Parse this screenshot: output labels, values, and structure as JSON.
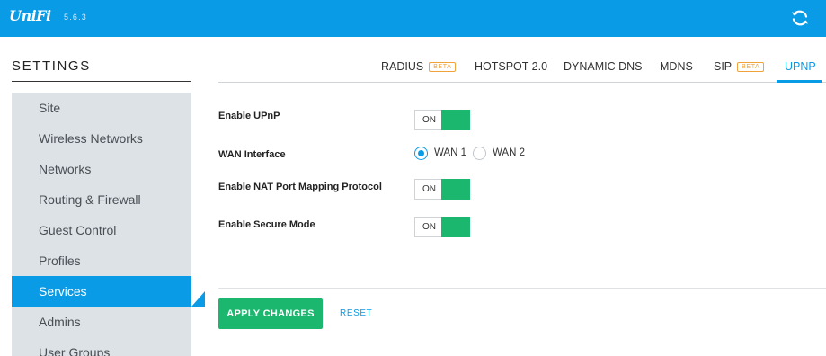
{
  "header": {
    "logo_text": "UniFi",
    "version": "5.6.3",
    "refresh_icon": "refresh-icon",
    "colors": {
      "bar": "#0a9be6"
    }
  },
  "sidebar": {
    "title": "SETTINGS",
    "items": [
      {
        "label": "Site"
      },
      {
        "label": "Wireless Networks"
      },
      {
        "label": "Networks"
      },
      {
        "label": "Routing & Firewall"
      },
      {
        "label": "Guest Control"
      },
      {
        "label": "Profiles"
      },
      {
        "label": "Services",
        "active": true
      },
      {
        "label": "Admins"
      },
      {
        "label": "User Groups"
      }
    ]
  },
  "tabs": {
    "items": [
      {
        "label": "RADIUS",
        "badge": "BETA"
      },
      {
        "label": "HOTSPOT 2.0"
      },
      {
        "label": "DYNAMIC DNS"
      },
      {
        "label": "MDNS"
      },
      {
        "label": "SIP",
        "badge": "BETA"
      },
      {
        "label": "UPNP",
        "active": true
      }
    ]
  },
  "form": {
    "enable_upnp": {
      "label": "Enable UPnP",
      "state": "ON"
    },
    "wan_interface": {
      "label": "WAN Interface",
      "options": [
        {
          "label": "WAN 1",
          "selected": true
        },
        {
          "label": "WAN 2",
          "selected": false
        }
      ]
    },
    "nat_pmp": {
      "label": "Enable NAT Port Mapping Protocol",
      "state": "ON"
    },
    "secure_mode": {
      "label": "Enable Secure Mode",
      "state": "ON"
    }
  },
  "actions": {
    "apply_label": "APPLY CHANGES",
    "reset_label": "RESET",
    "colors": {
      "apply": "#1bb76e",
      "accent": "#0a9be6"
    }
  }
}
